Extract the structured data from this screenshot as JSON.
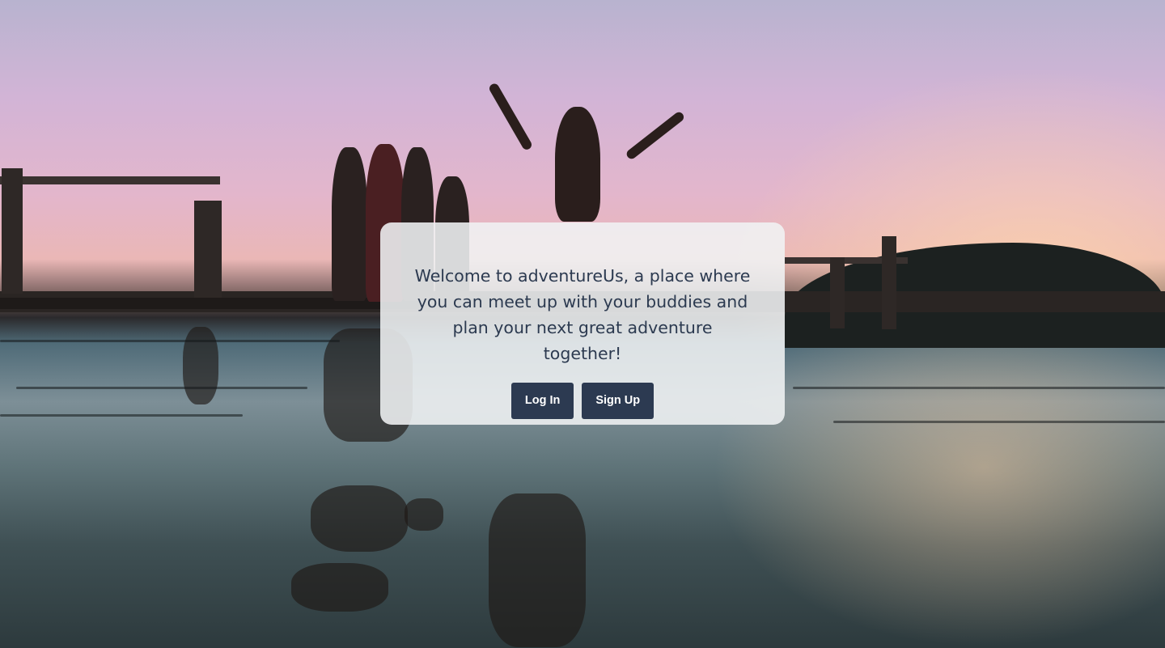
{
  "hero": {
    "background_description": "sunset photo background",
    "accent_color": "#2c3a51"
  },
  "welcome": {
    "message": "Welcome to adventureUs, a place where you can meet up with your buddies and plan your next great adventure together!"
  },
  "buttons": {
    "login_label": "Log In",
    "signup_label": "Sign Up"
  }
}
